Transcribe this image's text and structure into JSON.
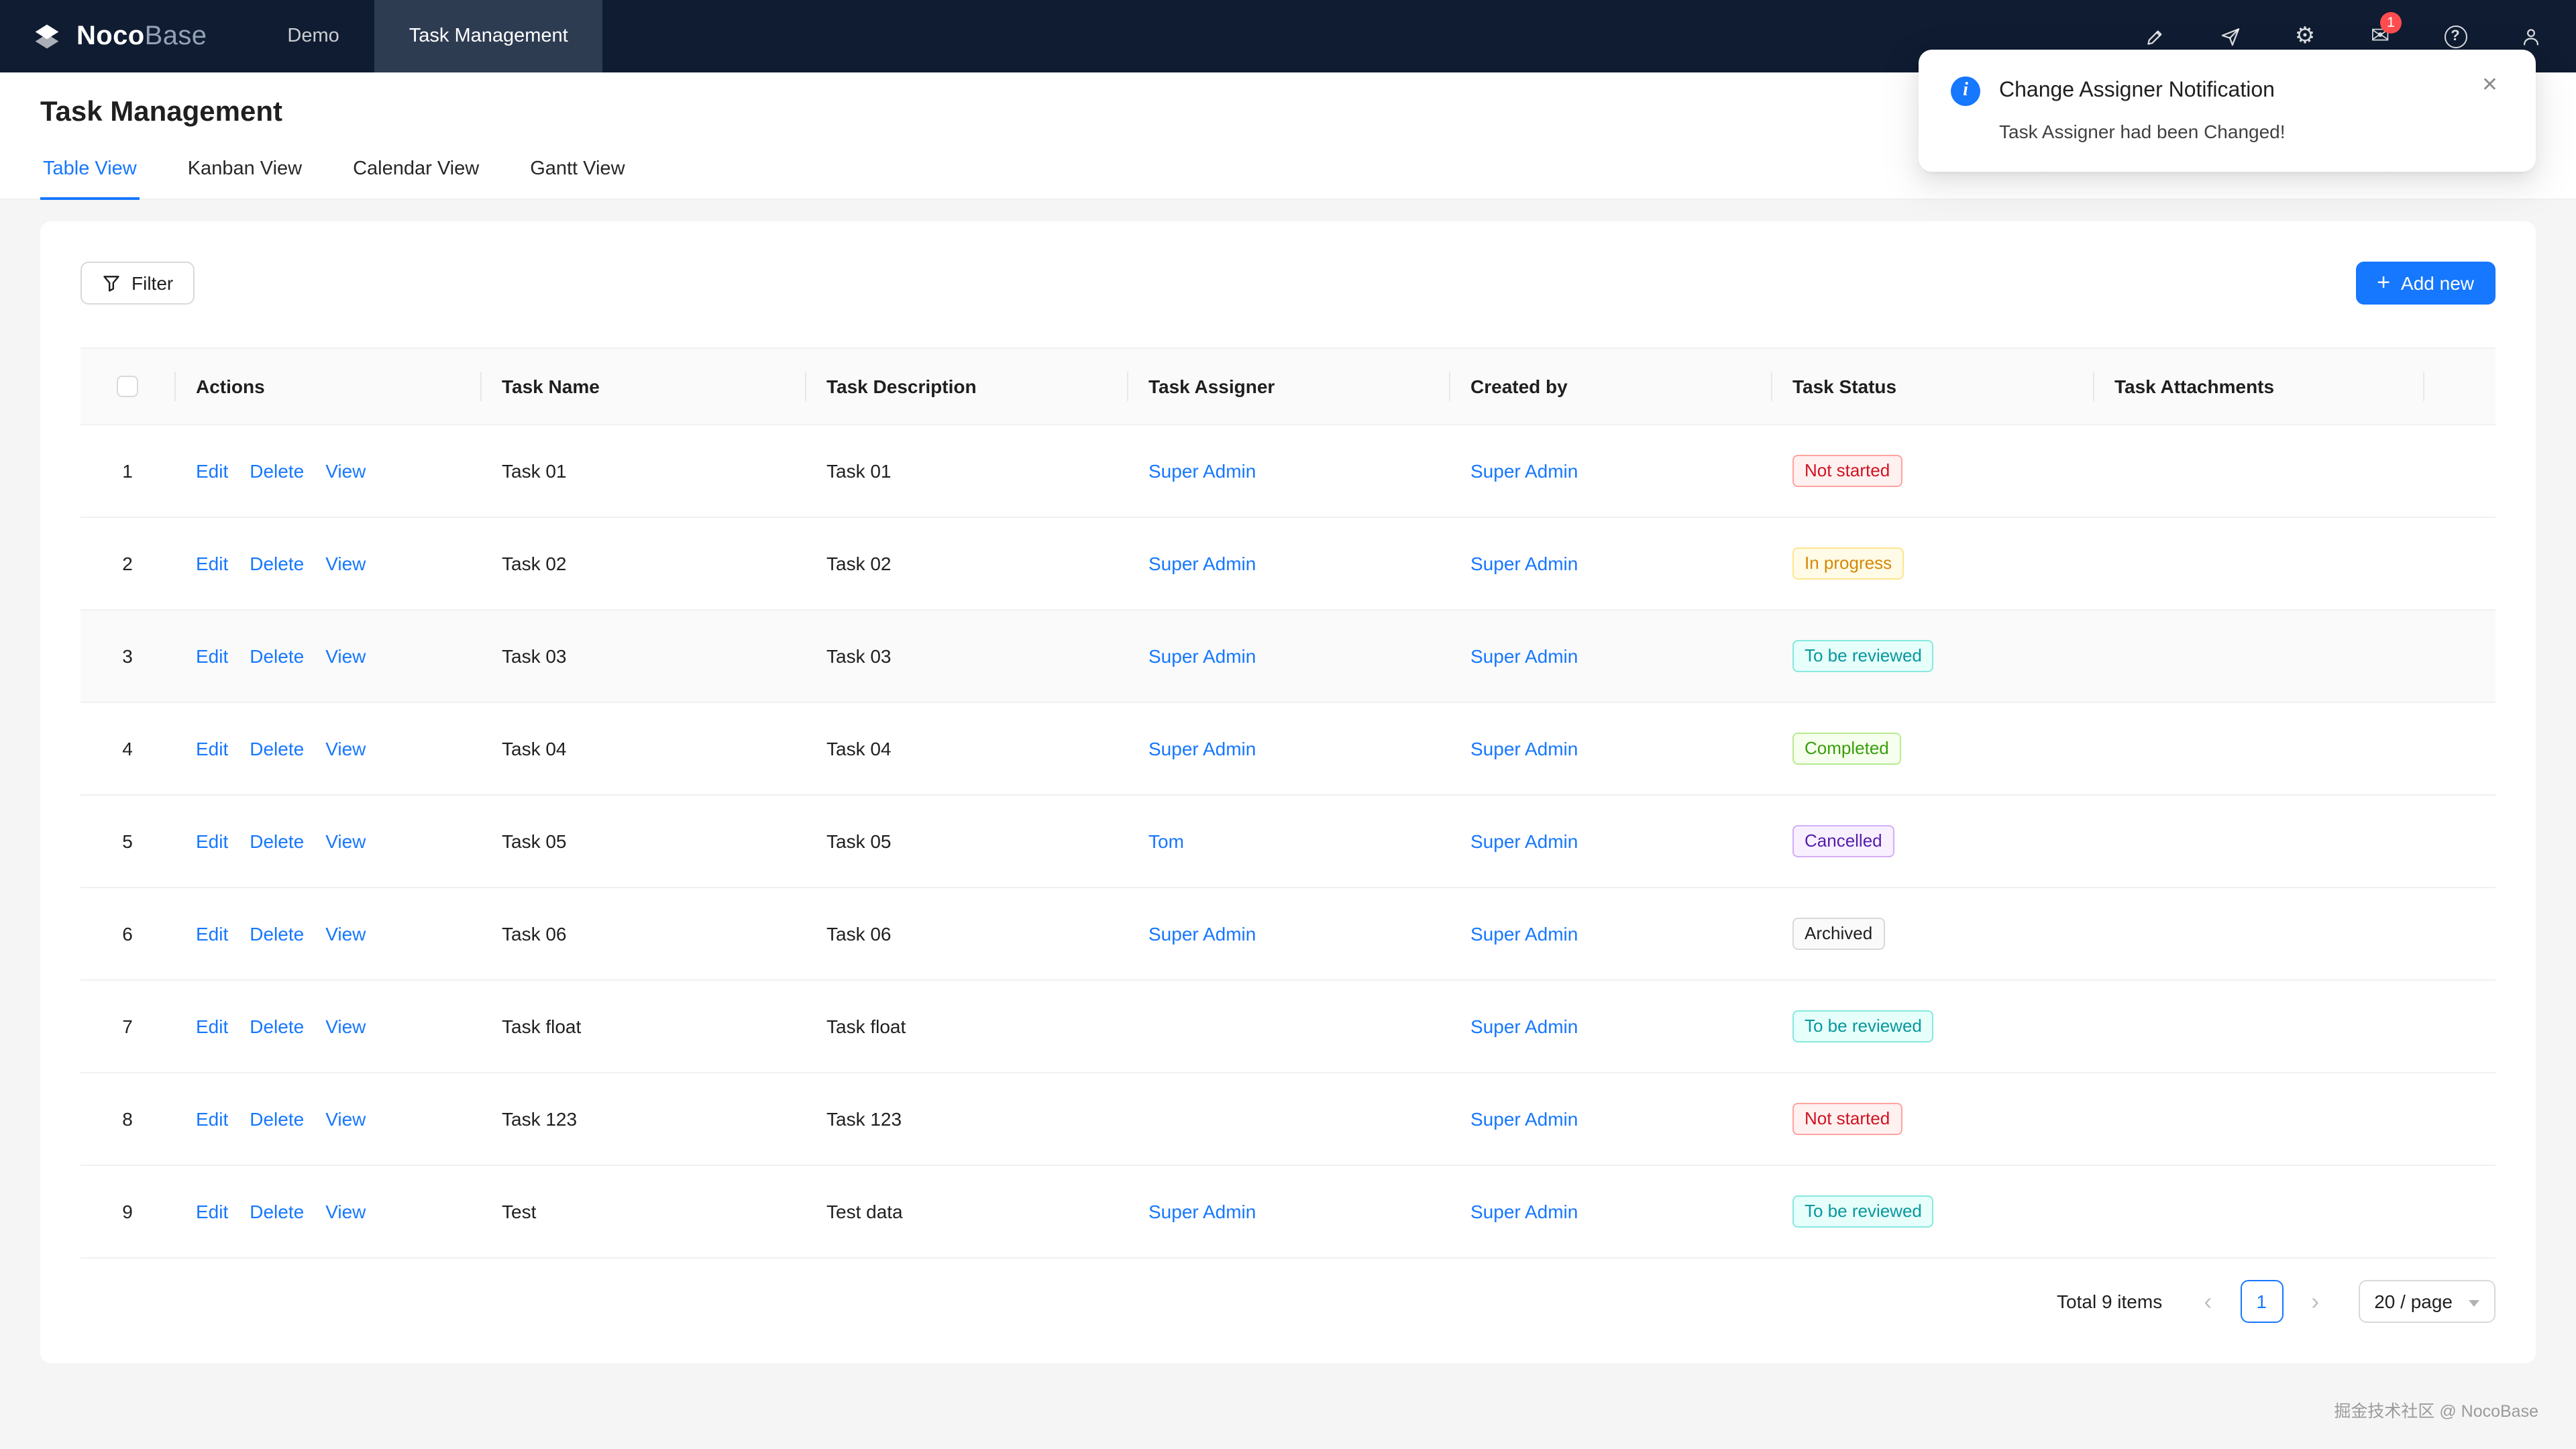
{
  "brand": {
    "name_primary": "Noco",
    "name_secondary": "Base"
  },
  "topnav": {
    "items": [
      {
        "label": "Demo",
        "active": false
      },
      {
        "label": "Task Management",
        "active": true
      }
    ],
    "icons": [
      {
        "name": "highlighter-icon"
      },
      {
        "name": "paper-plane-icon"
      },
      {
        "name": "gear-icon",
        "glyph": "⚙"
      },
      {
        "name": "mail-icon",
        "glyph": "✉",
        "badge": "1"
      },
      {
        "name": "question-circle-icon",
        "glyph": "?"
      },
      {
        "name": "user-icon"
      }
    ]
  },
  "notification": {
    "title": "Change Assigner Notification",
    "message": "Task Assigner had been Changed!",
    "close": "✕"
  },
  "page": {
    "title": "Task Management",
    "tabs": [
      {
        "label": "Table View",
        "active": true
      },
      {
        "label": "Kanban View",
        "active": false
      },
      {
        "label": "Calendar View",
        "active": false
      },
      {
        "label": "Gantt View",
        "active": false
      }
    ]
  },
  "toolbar": {
    "filter": "Filter",
    "add_new": "Add new",
    "add_icon": "+"
  },
  "table": {
    "columns": [
      "Actions",
      "Task Name",
      "Task Description",
      "Task Assigner",
      "Created by",
      "Task Status",
      "Task Attachments"
    ],
    "actions": [
      "Edit",
      "Delete",
      "View"
    ],
    "rows": [
      {
        "index": "1",
        "name": "Task 01",
        "description": "Task 01",
        "assigner": "Super Admin",
        "created_by": "Super Admin",
        "status": "Not started",
        "status_color": "red"
      },
      {
        "index": "2",
        "name": "Task 02",
        "description": "Task 02",
        "assigner": "Super Admin",
        "created_by": "Super Admin",
        "status": "In progress",
        "status_color": "gold"
      },
      {
        "index": "3",
        "name": "Task 03",
        "description": "Task 03",
        "assigner": "Super Admin",
        "created_by": "Super Admin",
        "status": "To be reviewed",
        "status_color": "cyan",
        "highlight": true
      },
      {
        "index": "4",
        "name": "Task 04",
        "description": "Task 04",
        "assigner": "Super Admin",
        "created_by": "Super Admin",
        "status": "Completed",
        "status_color": "green"
      },
      {
        "index": "5",
        "name": "Task 05",
        "description": "Task 05",
        "assigner": "Tom",
        "created_by": "Super Admin",
        "status": "Cancelled",
        "status_color": "purple"
      },
      {
        "index": "6",
        "name": "Task 06",
        "description": "Task 06",
        "assigner": "Super Admin",
        "created_by": "Super Admin",
        "status": "Archived",
        "status_color": "default"
      },
      {
        "index": "7",
        "name": "Task float",
        "description": "Task float",
        "assigner": "",
        "created_by": "Super Admin",
        "status": "To be reviewed",
        "status_color": "cyan"
      },
      {
        "index": "8",
        "name": "Task 123",
        "description": "Task 123",
        "assigner": "",
        "created_by": "Super Admin",
        "status": "Not started",
        "status_color": "red"
      },
      {
        "index": "9",
        "name": "Test",
        "description": "Test data",
        "assigner": "Super Admin",
        "created_by": "Super Admin",
        "status": "To be reviewed",
        "status_color": "cyan"
      }
    ]
  },
  "pagination": {
    "total": "Total 9 items",
    "prev_icon": "‹",
    "page": "1",
    "next_icon": "›",
    "page_size": "20 / page"
  },
  "watermark": "掘金技术社区 @ NocoBase",
  "colors": {
    "primary": "#1677ff",
    "navbar_bg": "#0f1c31",
    "badge_red": "#ff4d4f",
    "status": {
      "red": "#cf1322",
      "gold": "#d48806",
      "cyan": "#08979c",
      "green": "#389e0d",
      "purple": "#531dab",
      "default": "#595959"
    }
  }
}
